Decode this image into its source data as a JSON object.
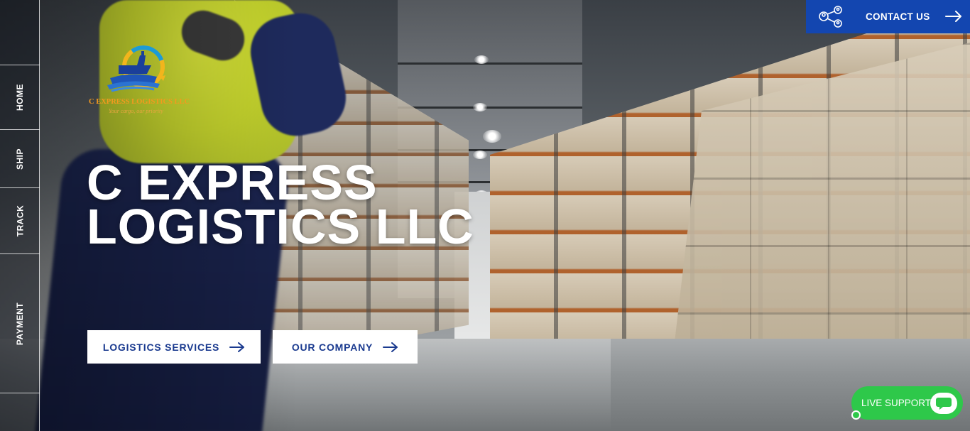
{
  "brand": {
    "name": "C EXPRESS LOGISTICS LLC",
    "tagline": "Your cargo, our priority",
    "accent_color": "#f39a1f"
  },
  "sidebar": {
    "items": [
      {
        "label": "HOME"
      },
      {
        "label": "SHIP"
      },
      {
        "label": "TRACK"
      },
      {
        "label": "PAYMENT"
      }
    ]
  },
  "header": {
    "contact": {
      "label": "CONTACT US",
      "icon": "network-people-icon",
      "background": "#1346b0"
    }
  },
  "hero": {
    "title_line1": "C EXPRESS",
    "title_line2": "LOGISTICS LLC",
    "buttons": [
      {
        "label": "LOGISTICS SERVICES",
        "icon": "arrow-right-icon"
      },
      {
        "label": "OUR COMPANY",
        "icon": "arrow-right-icon"
      }
    ],
    "button_text_color": "#1a3a8f"
  },
  "live_support": {
    "label": "LIVE SUPPORT",
    "icon": "chat-bubble-icon",
    "color": "#2ec84a"
  }
}
